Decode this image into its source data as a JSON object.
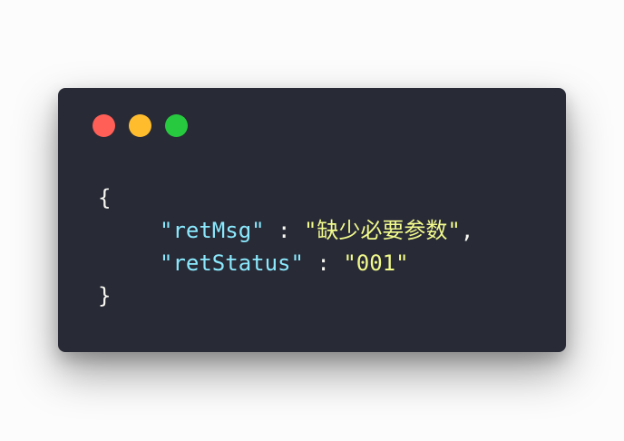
{
  "window": {
    "controls": [
      {
        "name": "close",
        "color": "#ff5f56"
      },
      {
        "name": "minimize",
        "color": "#ffbd2e"
      },
      {
        "name": "zoom",
        "color": "#27c93f"
      }
    ]
  },
  "code": {
    "open_brace": "{",
    "close_brace": "}",
    "lines": [
      {
        "key": "\"retMsg\"",
        "separator": " : ",
        "value": "\"缺少必要参数\"",
        "suffix": ","
      },
      {
        "key": "\"retStatus\"",
        "separator": " : ",
        "value": "\"001\"",
        "suffix": ""
      }
    ]
  },
  "theme": {
    "background": "#282a36",
    "key_color": "#8be9fd",
    "string_color": "#f1fa8c",
    "text_color": "#f8f8f2"
  }
}
